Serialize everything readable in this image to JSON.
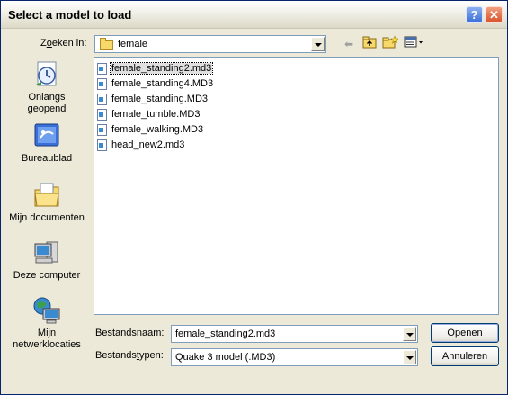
{
  "window": {
    "title": "Select a model to load",
    "help_label": "?",
    "close_label": "✕"
  },
  "lookin": {
    "label_pre": "Z",
    "label_ul": "o",
    "label_post": "eken in:",
    "value": "female"
  },
  "toolbar": {
    "back_icon": "back-arrow-icon",
    "up_icon": "up-folder-icon",
    "newfolder_icon": "new-folder-icon",
    "views_icon": "view-menu-icon"
  },
  "places": [
    {
      "label_l1": "Onlangs",
      "label_l2": "geopend",
      "icon": "recent-icon"
    },
    {
      "label_l1": "Bureaublad",
      "label_l2": "",
      "icon": "desktop-icon"
    },
    {
      "label_l1": "Mijn documenten",
      "label_l2": "",
      "icon": "my-documents-icon"
    },
    {
      "label_l1": "Deze computer",
      "label_l2": "",
      "icon": "my-computer-icon"
    },
    {
      "label_l1": "Mijn",
      "label_l2": "netwerklocaties",
      "icon": "network-icon"
    }
  ],
  "files": [
    {
      "name": "female_standing2.md3",
      "selected": true
    },
    {
      "name": "female_standing4.MD3",
      "selected": false
    },
    {
      "name": "female_standing.MD3",
      "selected": false
    },
    {
      "name": "female_tumble.MD3",
      "selected": false
    },
    {
      "name": "female_walking.MD3",
      "selected": false
    },
    {
      "name": "head_new2.md3",
      "selected": false
    }
  ],
  "filename": {
    "label_pre": "Bestands",
    "label_ul": "n",
    "label_post": "aam:",
    "value": "female_standing2.md3"
  },
  "filetype": {
    "label_pre": "Bestands",
    "label_ul": "t",
    "label_post": "ypen:",
    "value": "Quake 3 model  (.MD3)"
  },
  "buttons": {
    "open_ul": "O",
    "open_rest": "penen",
    "cancel": "Annuleren"
  }
}
